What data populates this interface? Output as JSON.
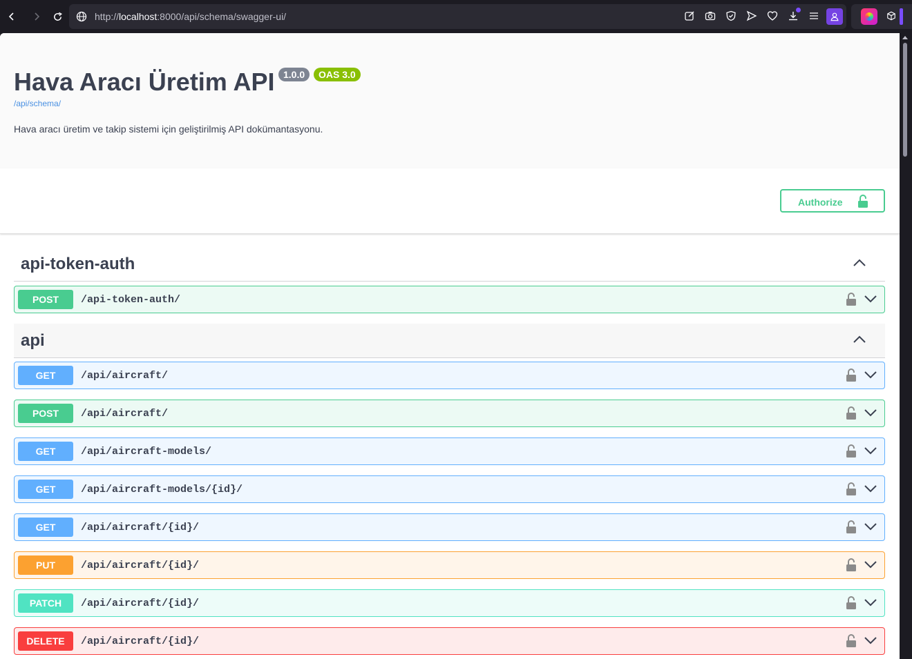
{
  "browser": {
    "url_prefix": "http://",
    "url_host": "localhost",
    "url_rest": ":8000/api/schema/swagger-ui/"
  },
  "info": {
    "title": "Hava Aracı Üretim API",
    "version": "1.0.0",
    "oas": "OAS 3.0",
    "schema_link": "/api/schema/",
    "description": "Hava aracı üretim ve takip sistemi için geliştirilmiş API dokümantasyonu."
  },
  "scheme": {
    "authorize_label": "Authorize"
  },
  "tags": [
    {
      "name": "api-token-auth"
    },
    {
      "name": "api"
    }
  ],
  "operations": [
    {
      "method": "POST",
      "path": "/api-token-auth/"
    },
    {
      "method": "GET",
      "path": "/api/aircraft/"
    },
    {
      "method": "POST",
      "path": "/api/aircraft/"
    },
    {
      "method": "GET",
      "path": "/api/aircraft-models/"
    },
    {
      "method": "GET",
      "path": "/api/aircraft-models/{id}/"
    },
    {
      "method": "GET",
      "path": "/api/aircraft/{id}/"
    },
    {
      "method": "PUT",
      "path": "/api/aircraft/{id}/"
    },
    {
      "method": "PATCH",
      "path": "/api/aircraft/{id}/"
    },
    {
      "method": "DELETE",
      "path": "/api/aircraft/{id}/"
    }
  ],
  "colors": {
    "get": "#61affe",
    "post": "#49cc90",
    "put": "#fca130",
    "patch": "#50e3c2",
    "delete": "#f93e3e"
  }
}
